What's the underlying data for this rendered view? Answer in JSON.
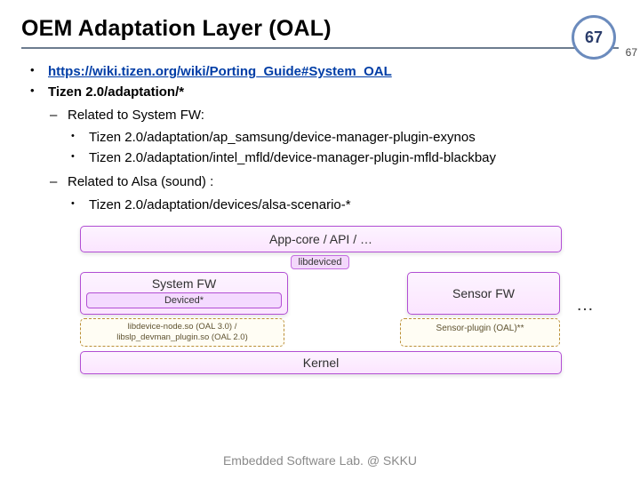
{
  "header": {
    "title": "OEM Adaptation Layer (OAL)",
    "badge_number": "67",
    "page_number_side": "67"
  },
  "bullets": {
    "link": "https://wiki.tizen.org/wiki/Porting_Guide#System_OAL",
    "item2": "Tizen 2.0/adaptation/*",
    "sub1_label": "Related to System FW:",
    "sub1_a": "Tizen 2.0/adaptation/ap_samsung/device-manager-plugin-exynos",
    "sub1_b": "Tizen 2.0/adaptation/intel_mfld/device-manager-plugin-mfld-blackbay",
    "sub2_label": "Related to Alsa (sound) :",
    "sub2_a": "Tizen 2.0/adaptation/devices/alsa-scenario-*"
  },
  "diagram": {
    "appcore": "App-core / API / …",
    "libdeviced": "libdeviced",
    "systemfw": "System FW",
    "deviced": "Deviced*",
    "sensorfw": "Sensor FW",
    "oal_left_line1": "libdevice-node.so (OAL 3.0) /",
    "oal_left_line2": "libslp_devman_plugin.so (OAL 2.0)",
    "oal_right": "Sensor-plugin (OAL)**",
    "kernel": "Kernel",
    "ellipsis": "…"
  },
  "footer": "Embedded Software Lab. @ SKKU"
}
